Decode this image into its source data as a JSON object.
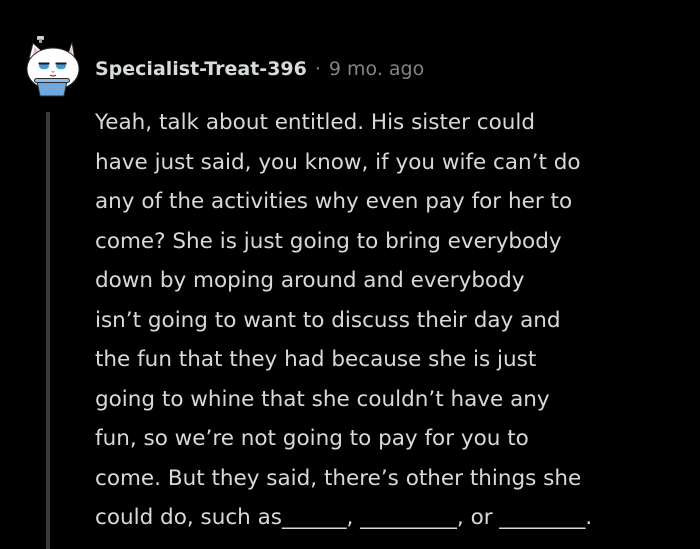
{
  "comment": {
    "username": "Specialist-Treat-396",
    "separator": "·",
    "timestamp": "9 mo. ago",
    "avatar_icon": "cat-avatar-icon",
    "body": "Yeah, talk about entitled. His sister could\nhave just said, you know, if you wife can’t do\nany of the activities why even pay for her to\ncome? She is just going to bring everybody\ndown by moping around and everybody\nisn’t going to want to discuss their day and\nthe fun that they had because she is just\ngoing to whine that she couldn’t have any\nfun, so we’re not going to pay for you to\ncome. But they said, there’s other things she\ncould do, such as______, _________, or ________."
  },
  "colors": {
    "background": "#000000",
    "text": "#d7dadc",
    "meta": "#818384",
    "thread_line": "#3a3a3c"
  }
}
